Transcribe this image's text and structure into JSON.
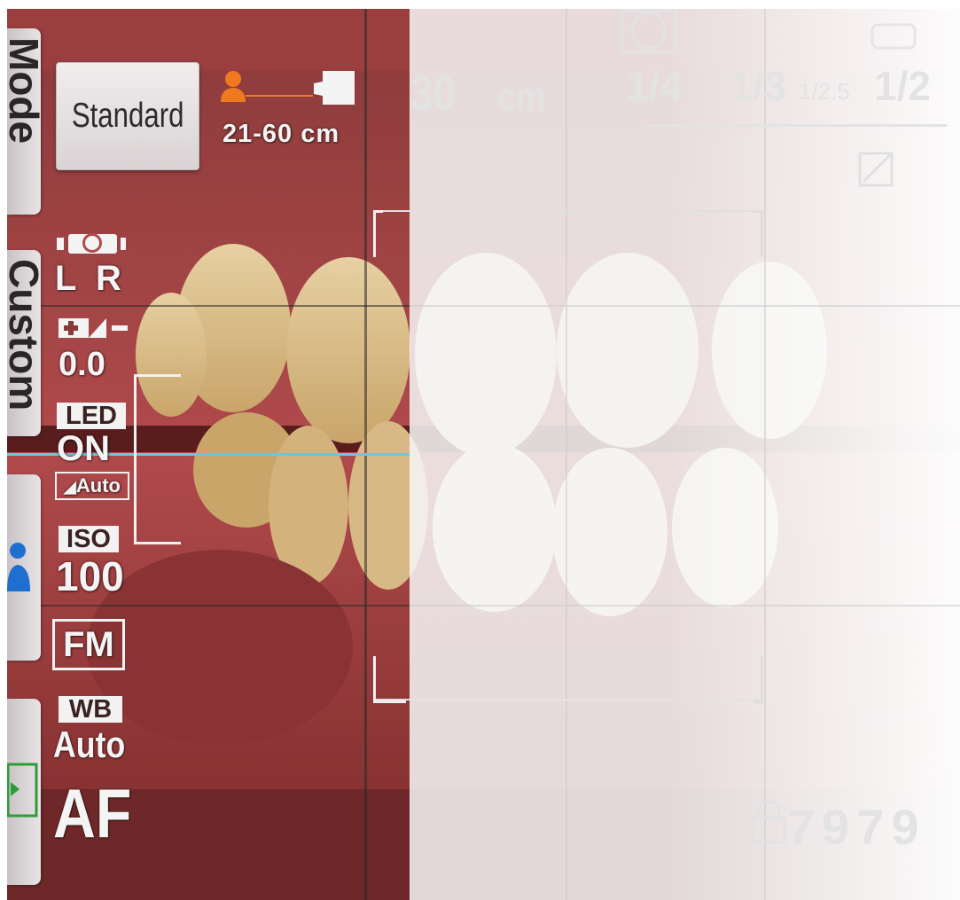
{
  "side_tabs": {
    "mode": "Mode",
    "custom": "Custom"
  },
  "shooting_mode": {
    "label": "Standard"
  },
  "focus_range": {
    "text": "21-60 cm",
    "icon": "person-to-camera-icon",
    "accent": "#f07a20"
  },
  "distance": {
    "value": "30",
    "unit": "cm"
  },
  "magnification": [
    "1/4",
    "1/3",
    "1/2.5",
    "1/2"
  ],
  "flash": {
    "left": "L",
    "right": "R",
    "icon": "ring-flash-icon"
  },
  "exposure": {
    "value": "0.0",
    "icon": "exposure-compensation-icon"
  },
  "led": {
    "label": "LED",
    "state": "ON",
    "mode": "Auto"
  },
  "iso": {
    "label": "ISO",
    "value": "100"
  },
  "metering": {
    "label": "FM"
  },
  "white_balance": {
    "label": "WB",
    "value": "Auto"
  },
  "focus": {
    "label": "AF"
  },
  "shots_remaining": {
    "value": "7979"
  },
  "colors": {
    "level_line": "#6fc6d6",
    "mode_accent": "#1e6fd0",
    "playback_green": "#2f9b3a"
  }
}
